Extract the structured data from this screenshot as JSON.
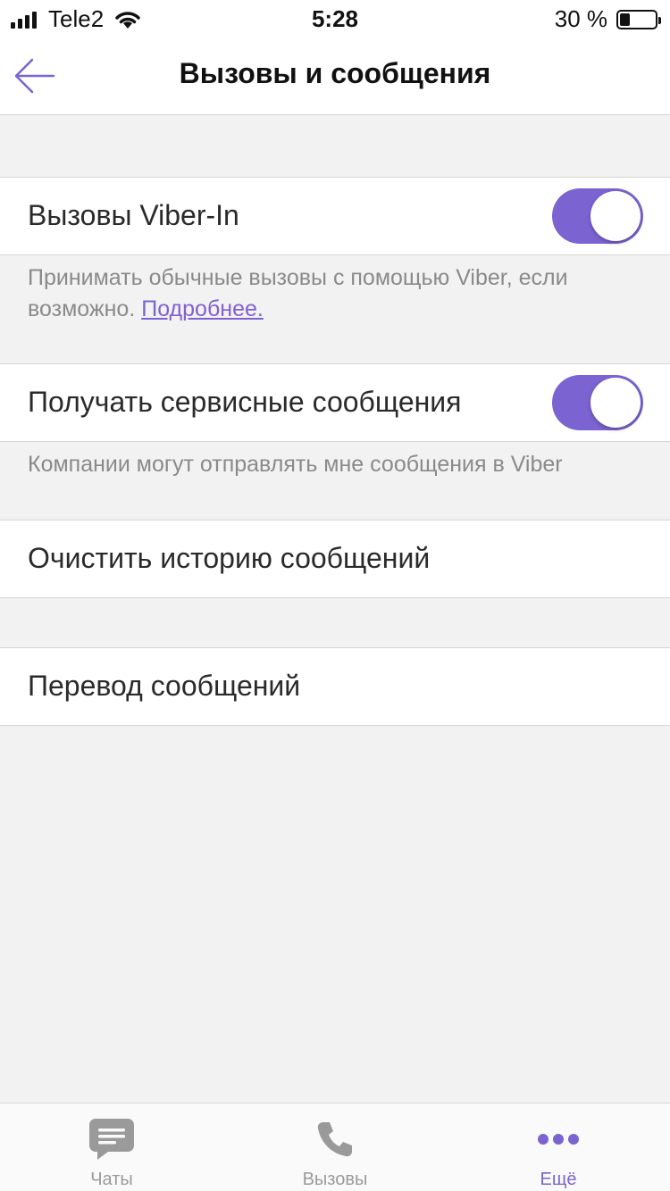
{
  "status_bar": {
    "carrier": "Tele2",
    "time": "5:28",
    "battery": "30 %",
    "battery_level": 0.3
  },
  "header": {
    "title": "Вызовы и сообщения"
  },
  "settings": {
    "viber_in": {
      "label": "Вызовы Viber-In",
      "enabled": true,
      "description": "Принимать обычные вызовы с помощью Viber, если возможно.",
      "link": "Подробнее."
    },
    "service_messages": {
      "label": "Получать сервисные сообщения",
      "enabled": true,
      "description": "Компании могут отправлять мне сообщения в Viber"
    },
    "clear_history": {
      "label": "Очистить историю сообщений"
    },
    "translation": {
      "label": "Перевод сообщений"
    }
  },
  "tab_bar": {
    "tabs": [
      {
        "label": "Чаты",
        "icon": "chat-bubble-icon",
        "active": false
      },
      {
        "label": "Вызовы",
        "icon": "phone-icon",
        "active": false
      },
      {
        "label": "Ещё",
        "icon": "more-dots-icon",
        "active": true
      }
    ]
  },
  "colors": {
    "accent": "#7b63d1",
    "background": "#f2f2f2",
    "inactive_tab": "#9a9a9a"
  }
}
